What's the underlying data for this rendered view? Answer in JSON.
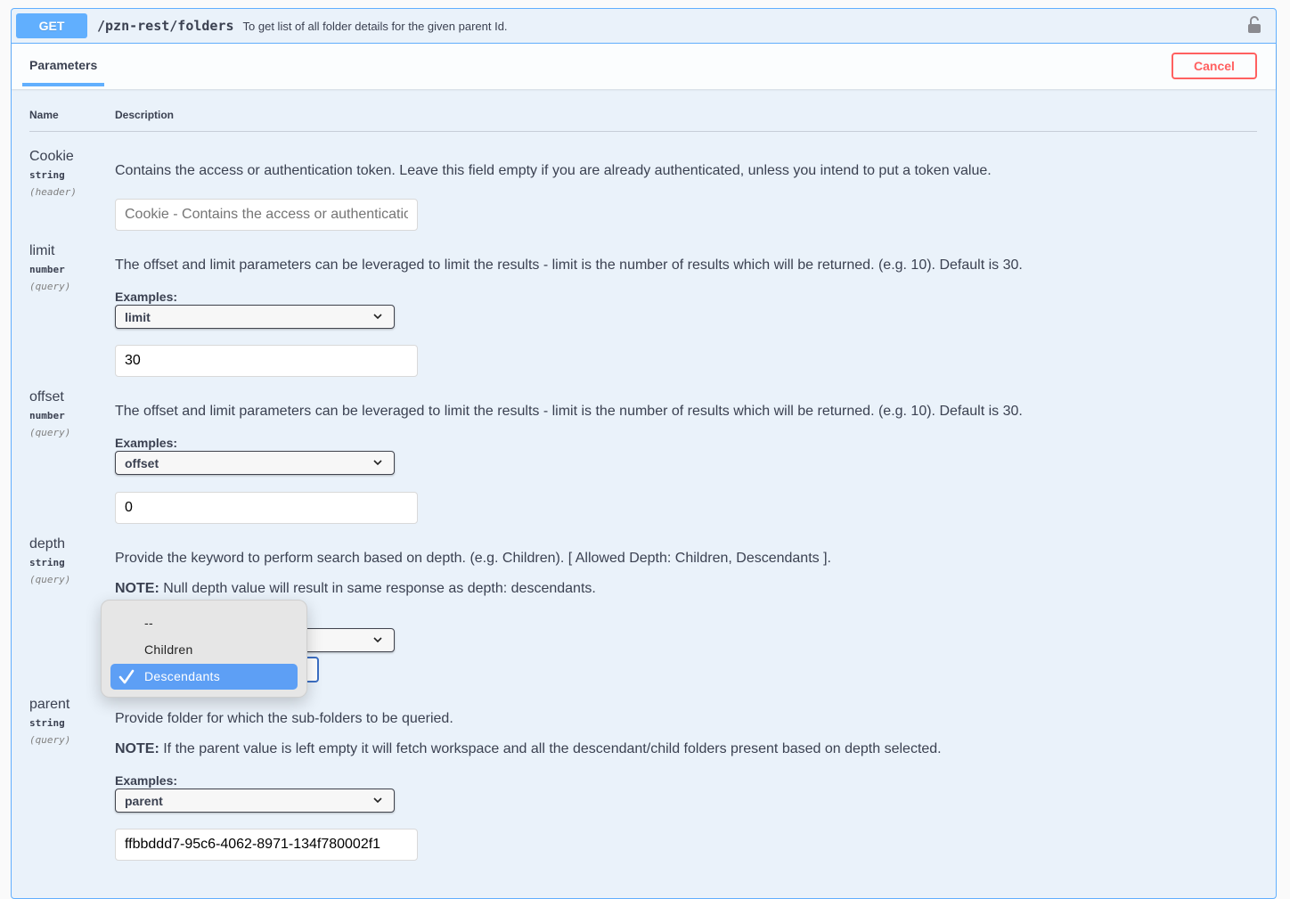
{
  "operation": {
    "method": "GET",
    "path": "/pzn-rest/folders",
    "summary": "To get list of all folder details for the given parent Id.",
    "lock_icon": "unlocked-padlock-icon"
  },
  "tabs": {
    "parameters": "Parameters",
    "cancel": "Cancel"
  },
  "table": {
    "name_header": "Name",
    "description_header": "Description"
  },
  "params": [
    {
      "name": "Cookie",
      "type": "string",
      "in": "(header)",
      "description": "Contains the access or authentication token. Leave this field empty if you are already authenticated, unless you intend to put a token value.",
      "input_value": "",
      "input_placeholder": "Cookie - Contains the access or authentication token. Leave this field empty if you are already authenticated"
    },
    {
      "name": "limit",
      "type": "number",
      "in": "(query)",
      "description": "The offset and limit parameters can be leveraged to limit the results - limit is the number of results which will be returned. (e.g. 10). Default is 30.",
      "examples_label": "Examples:",
      "example_selected": "limit",
      "input_value": "30"
    },
    {
      "name": "offset",
      "type": "number",
      "in": "(query)",
      "description": "The offset and limit parameters can be leveraged to limit the results - limit is the number of results which will be returned. (e.g. 10). Default is 30.",
      "examples_label": "Examples:",
      "example_selected": "offset",
      "input_value": "0"
    },
    {
      "name": "depth",
      "type": "string",
      "in": "(query)",
      "description": "Provide the keyword to perform search based on depth. (e.g. Children). [ Allowed Depth: Children, Descendants ].",
      "note_label": "NOTE:",
      "note": " Null depth value will result in same response as depth: descendants.",
      "dropdown_options": [
        "--",
        "Children",
        "Descendants"
      ],
      "dropdown_selected": "Descendants"
    },
    {
      "name": "parent",
      "type": "string",
      "in": "(query)",
      "description": "Provide folder for which the sub-folders to be queried.",
      "note_label": "NOTE:",
      "note": " If the parent value is left empty it will fetch workspace and all the descendant/child folders present based on depth selected.",
      "examples_label": "Examples:",
      "example_selected": "parent",
      "input_value": "ffbbddd7-95c6-4062-8971-134f780002f1"
    }
  ],
  "colors": {
    "get": "#61affe",
    "cancel": "#ff6060",
    "selected_option": "#5d9ff5"
  }
}
